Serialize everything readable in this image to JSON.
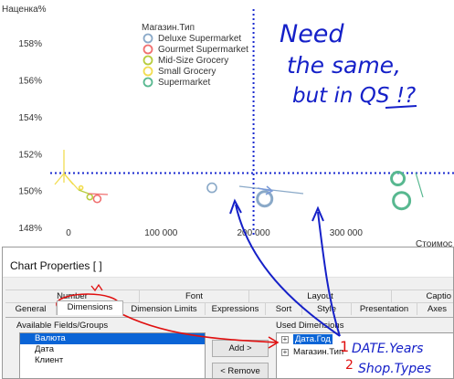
{
  "chart_data": {
    "type": "scatter",
    "ylabel": "Наценка%",
    "xlabel": "Стоимос",
    "x_ticks": [
      "0",
      "100 000",
      "200 000",
      "300 000"
    ],
    "y_ticks": [
      "148%",
      "150%",
      "152%",
      "154%",
      "156%",
      "158%"
    ],
    "xlim": [
      0,
      390000
    ],
    "ylim": [
      148,
      159
    ],
    "legend": {
      "title": "Магазин.Тип",
      "position": "top-center",
      "items": [
        {
          "label": "Deluxe Supermarket",
          "color": "#8aa9c8"
        },
        {
          "label": "Gourmet Supermarket",
          "color": "#f07070"
        },
        {
          "label": "Mid-Size Grocery",
          "color": "#b7cc3d"
        },
        {
          "label": "Small Grocery",
          "color": "#f2dd50"
        },
        {
          "label": "Supermarket",
          "color": "#58b890"
        }
      ]
    },
    "series": [
      {
        "name": "Deluxe Supermarket",
        "color": "#8aa9c8",
        "points": [
          [
            155000,
            150.2,
            5
          ],
          [
            212000,
            149.6,
            8
          ]
        ]
      },
      {
        "name": "Gourmet Supermarket",
        "color": "#f07070",
        "points": [
          [
            31000,
            149.6,
            4
          ]
        ]
      },
      {
        "name": "Mid-Size Grocery",
        "color": "#b7cc3d",
        "points": [
          [
            23000,
            149.7,
            3
          ]
        ]
      },
      {
        "name": "Small Grocery",
        "color": "#f2dd50",
        "points": [
          [
            13500,
            150.2,
            2
          ]
        ]
      },
      {
        "name": "Supermarket",
        "color": "#58b890",
        "points": [
          [
            356000,
            150.7,
            7
          ],
          [
            360000,
            149.5,
            9
          ]
        ]
      }
    ],
    "reference_lines": {
      "x": 200000,
      "y": 151.0
    },
    "grid": false
  },
  "dialog": {
    "title": "Chart Properties [ ]",
    "tabs_row1": [
      "Number",
      "Font",
      "Layout",
      "Captio"
    ],
    "tabs_row2": [
      "General",
      "Dimensions",
      "Dimension Limits",
      "Expressions",
      "Sort",
      "Style",
      "Presentation",
      "Axes"
    ],
    "active_tab": "Dimensions",
    "available_label": "Available Fields/Groups",
    "available_items": [
      "Валюта",
      "Дата",
      "Клиент"
    ],
    "add_button": "Add >",
    "remove_button": "< Remove",
    "used_label": "Used Dimensions",
    "used_items": [
      "Дата.Год",
      "Магазин.Тип"
    ]
  },
  "annotations": {
    "note_line1": "Need",
    "note_line2": "the same,",
    "note_line3": "but in QS !?",
    "num1": "1",
    "label1": "DATE.Years",
    "num2": "2",
    "label2": "Shop.Types",
    "ink_color": "#1520c8",
    "red_ink": "#e01010"
  }
}
